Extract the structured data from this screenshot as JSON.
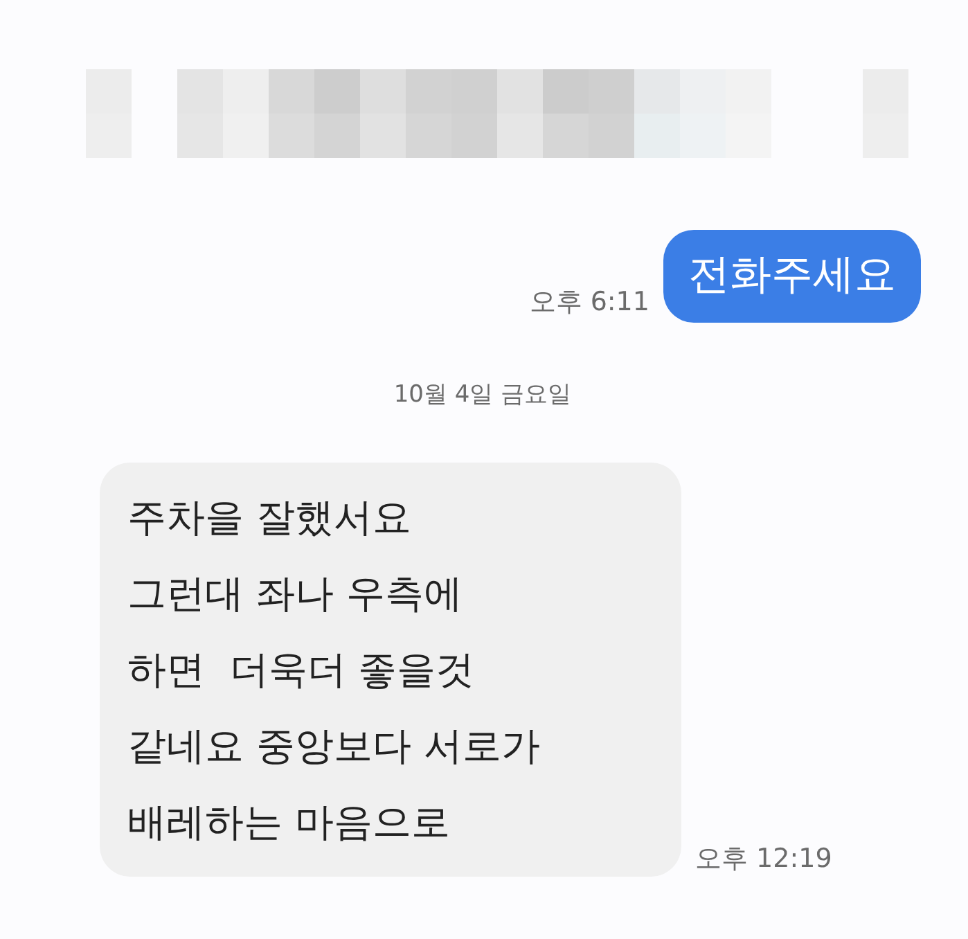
{
  "messages": [
    {
      "kind": "sent",
      "lines": [
        "전화주세요"
      ],
      "time": "오후 6:11"
    },
    {
      "kind": "date",
      "text": "10월 4일 금요일"
    },
    {
      "kind": "received",
      "lines": [
        "주차을 잘했서요",
        "그런대 좌나 우측에",
        "하면  더욱더 좋을것",
        "같네요 중앙보다 서로가",
        "배레하는 마음으로"
      ],
      "time": "오후 12:19"
    }
  ]
}
